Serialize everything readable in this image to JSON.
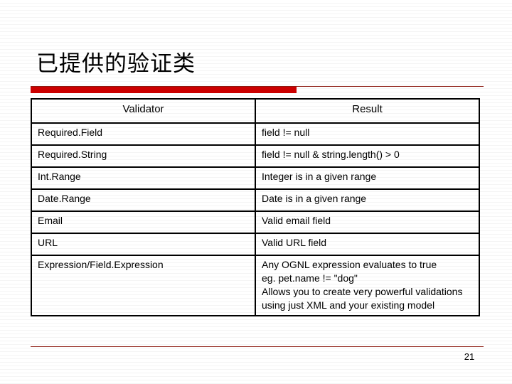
{
  "slide": {
    "title": "已提供的验证类",
    "page_number": "21",
    "accent_color": "#cc0000",
    "rule_color": "#8c1a10"
  },
  "table": {
    "headers": [
      "Validator",
      "Result"
    ],
    "rows": [
      {
        "validator": "Required.Field",
        "result": "field != null"
      },
      {
        "validator": "Required.String",
        "result": "field != null & string.length() > 0"
      },
      {
        "validator": "Int.Range",
        "result": "Integer is in a given range"
      },
      {
        "validator": "Date.Range",
        "result": "Date is in a given range"
      },
      {
        "validator": "Email",
        "result": "Valid email field"
      },
      {
        "validator": "URL",
        "result": "Valid URL field"
      },
      {
        "validator": "Expression/Field.Expression",
        "result": "Any OGNL expression evaluates to true\neg. pet.name != \"dog\"\nAllows you to create very powerful validations using just XML and your existing model"
      }
    ]
  }
}
